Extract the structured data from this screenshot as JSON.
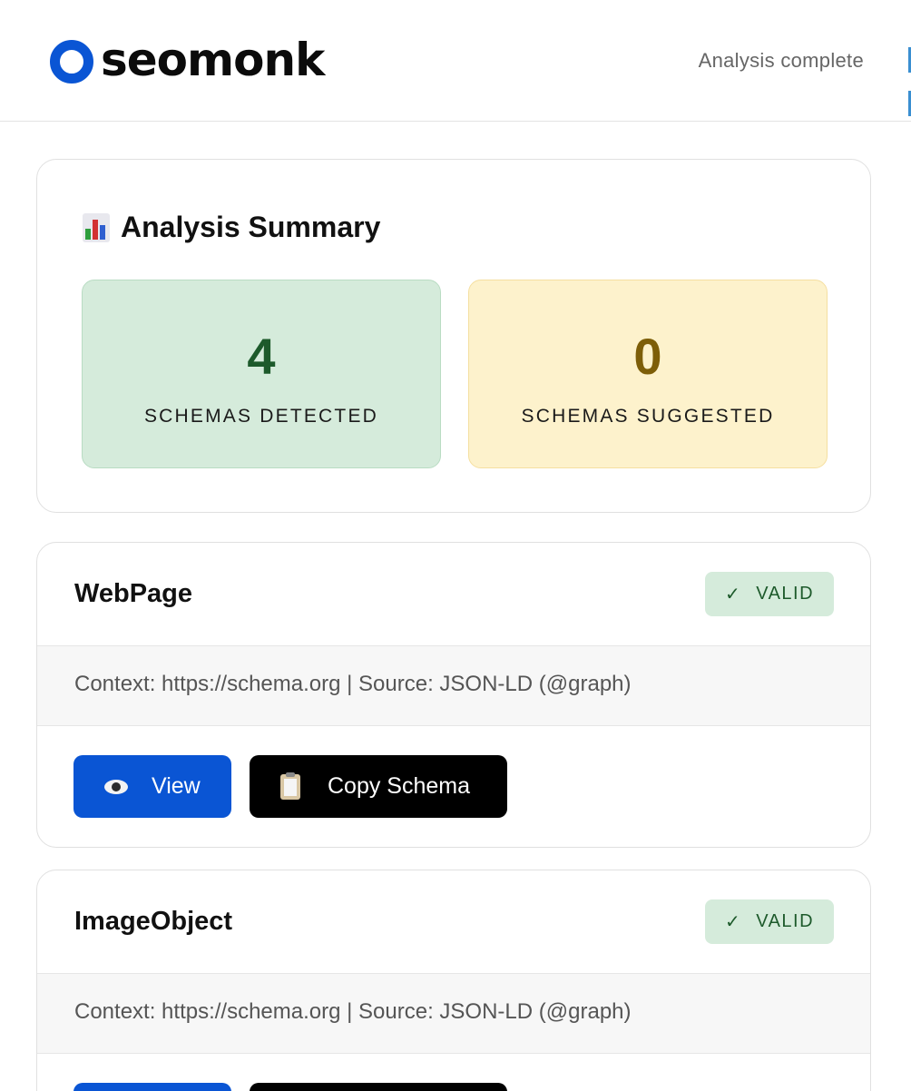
{
  "header": {
    "brand": "seomonk",
    "status": "Analysis complete"
  },
  "summary": {
    "title": "Analysis Summary",
    "icon": "bar-chart-icon",
    "detected": {
      "value": "4",
      "label": "SCHEMAS DETECTED",
      "color": "#d5ebdb"
    },
    "suggested": {
      "value": "0",
      "label": "SCHEMAS SUGGESTED",
      "color": "#fdf2cc"
    }
  },
  "schemas": [
    {
      "name": "WebPage",
      "status": "VALID",
      "meta": "Context: https://schema.org | Source: JSON-LD (@graph)",
      "view_label": "View",
      "copy_label": "Copy Schema"
    },
    {
      "name": "ImageObject",
      "status": "VALID",
      "meta": "Context: https://schema.org | Source: JSON-LD (@graph)"
    }
  ],
  "colors": {
    "accent": "#0a55d4",
    "valid_bg": "#d5ebdb",
    "valid_text": "#1d5a2b"
  }
}
